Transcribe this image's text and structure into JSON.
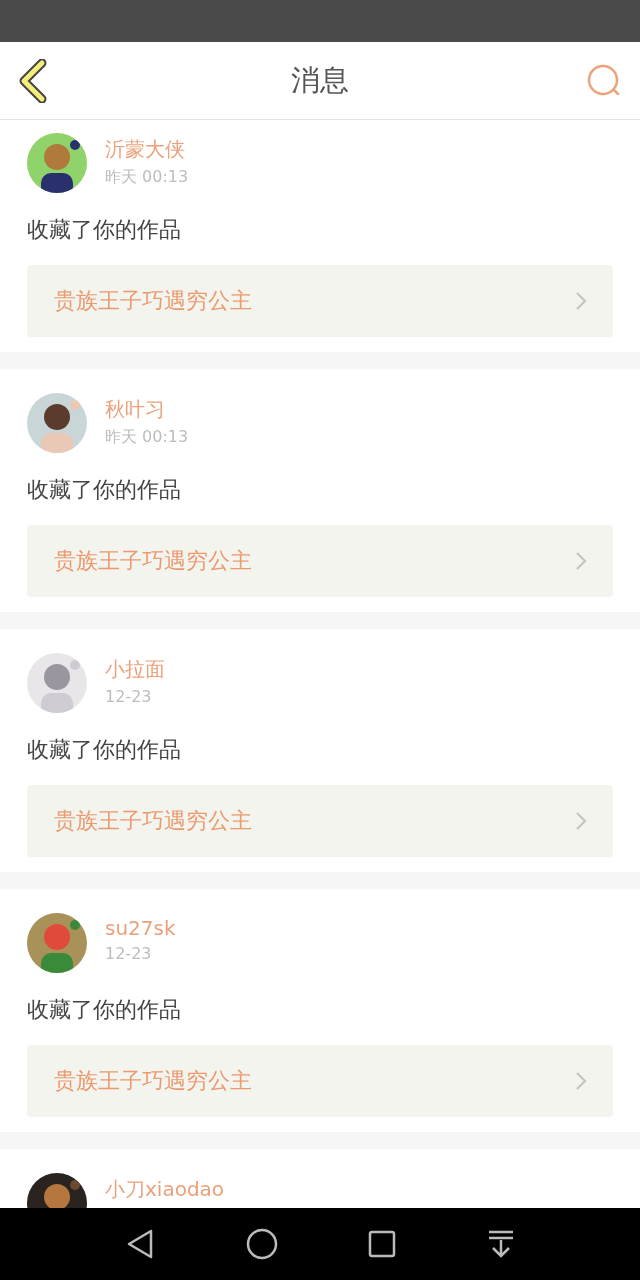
{
  "header": {
    "title": "消息"
  },
  "messages": [
    {
      "name": "沂蒙大侠",
      "time": "昨天 00:13",
      "text": "收藏了你的作品",
      "work": "贵族王子巧遇穷公主"
    },
    {
      "name": "秋叶习",
      "time": "昨天 00:13",
      "text": "收藏了你的作品",
      "work": "贵族王子巧遇穷公主"
    },
    {
      "name": "小拉面",
      "time": "12-23",
      "text": "收藏了你的作品",
      "work": "贵族王子巧遇穷公主"
    },
    {
      "name": "su27sk",
      "time": "12-23",
      "text": "收藏了你的作品",
      "work": "贵族王子巧遇穷公主"
    },
    {
      "name": "小刀xiaodao"
    }
  ]
}
